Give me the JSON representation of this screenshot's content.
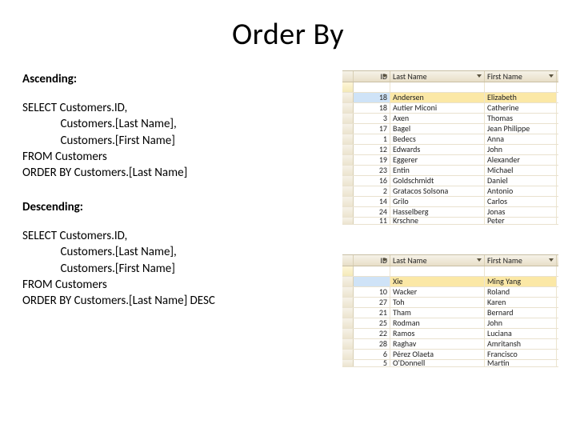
{
  "title": "Order By",
  "labels": {
    "asc": "Ascending:",
    "desc": "Descending:"
  },
  "sql": {
    "asc": "SELECT Customers.ID,\n              Customers.[Last Name],\n              Customers.[First Name]\nFROM Customers\nORDER BY Customers.[Last Name]",
    "desc": "SELECT Customers.ID,\n              Customers.[Last Name],\n              Customers.[First Name]\nFROM Customers\nORDER BY Customers.[Last Name] DESC"
  },
  "grid_headers": {
    "id": "ID",
    "last": "Last Name",
    "first": "First Name"
  },
  "grid_asc": [
    {
      "id": "",
      "last": "",
      "first": "",
      "new": true
    },
    {
      "id": "18",
      "last": "Andersen",
      "first": "Elizabeth",
      "sel": true
    },
    {
      "id": "18",
      "last": "Autier Miconi",
      "first": "Catherine"
    },
    {
      "id": "3",
      "last": "Axen",
      "first": "Thomas"
    },
    {
      "id": "17",
      "last": "Bagel",
      "first": "Jean Philippe"
    },
    {
      "id": "1",
      "last": "Bedecs",
      "first": "Anna"
    },
    {
      "id": "12",
      "last": "Edwards",
      "first": "John"
    },
    {
      "id": "19",
      "last": "Eggerer",
      "first": "Alexander"
    },
    {
      "id": "23",
      "last": "Entin",
      "first": "Michael"
    },
    {
      "id": "16",
      "last": "Goldschmidt",
      "first": "Daniel"
    },
    {
      "id": "2",
      "last": "Gratacos Solsona",
      "first": "Antonio"
    },
    {
      "id": "14",
      "last": "Grilo",
      "first": "Carlos"
    },
    {
      "id": "24",
      "last": "Hasselberg",
      "first": "Jonas"
    },
    {
      "id": "11",
      "last": "Krschne",
      "first": "Peter",
      "cut": true
    }
  ],
  "grid_desc": [
    {
      "id": "",
      "last": "",
      "first": "",
      "new": true
    },
    {
      "id": "",
      "last": "Xie",
      "first": "Ming Yang",
      "sel": true
    },
    {
      "id": "10",
      "last": "Wacker",
      "first": "Roland"
    },
    {
      "id": "27",
      "last": "Toh",
      "first": "Karen"
    },
    {
      "id": "21",
      "last": "Tham",
      "first": "Bernard"
    },
    {
      "id": "25",
      "last": "Rodman",
      "first": "John"
    },
    {
      "id": "22",
      "last": "Ramos",
      "first": "Luciana"
    },
    {
      "id": "28",
      "last": "Raghav",
      "first": "Amritansh"
    },
    {
      "id": "6",
      "last": "Pérez Olaeta",
      "first": "Francisco"
    },
    {
      "id": "5",
      "last": "O'Donnell",
      "first": "Martin",
      "cut": true
    }
  ]
}
